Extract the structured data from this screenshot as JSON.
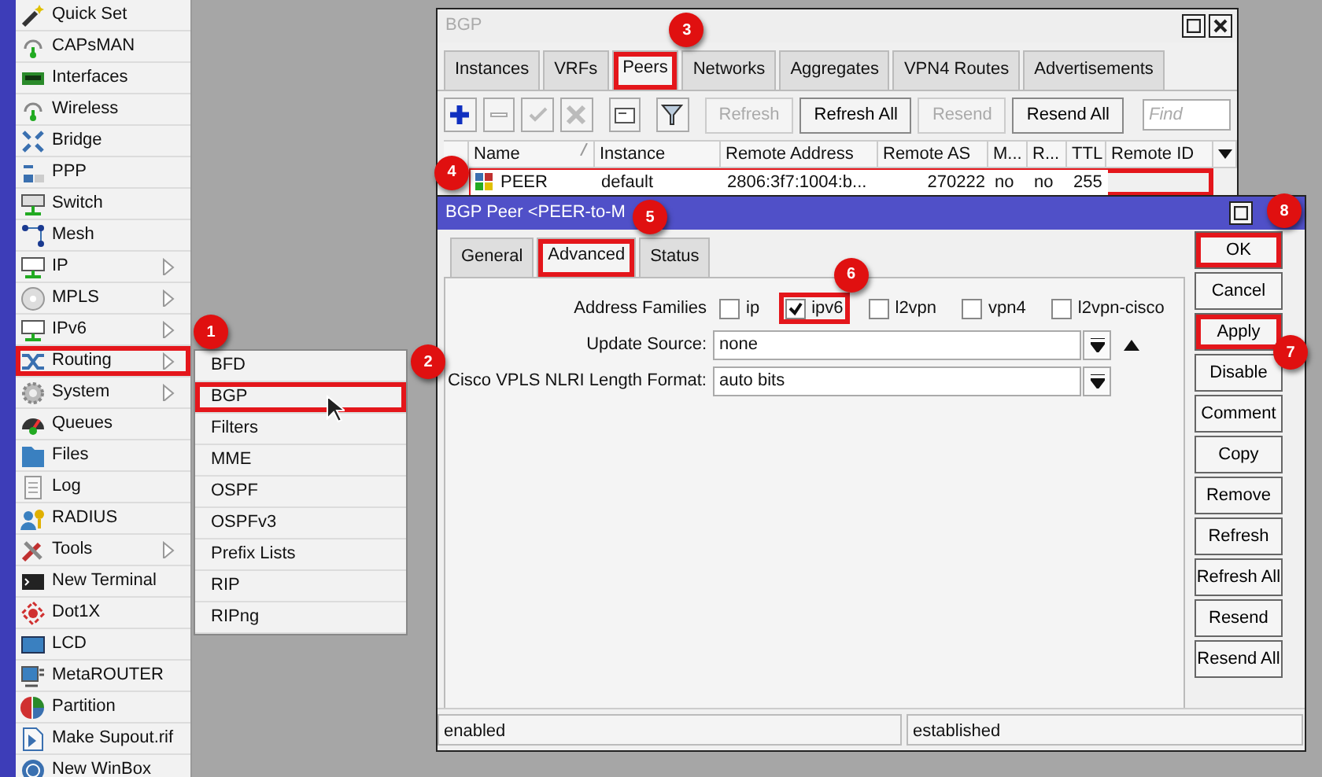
{
  "sidebar": {
    "items": [
      {
        "label": "Quick Set",
        "submenu": false
      },
      {
        "label": "CAPsMAN",
        "submenu": false
      },
      {
        "label": "Interfaces",
        "submenu": false
      },
      {
        "label": "Wireless",
        "submenu": false
      },
      {
        "label": "Bridge",
        "submenu": false
      },
      {
        "label": "PPP",
        "submenu": false
      },
      {
        "label": "Switch",
        "submenu": false
      },
      {
        "label": "Mesh",
        "submenu": false
      },
      {
        "label": "IP",
        "submenu": true
      },
      {
        "label": "MPLS",
        "submenu": true
      },
      {
        "label": "IPv6",
        "submenu": true
      },
      {
        "label": "Routing",
        "submenu": true,
        "marked": true,
        "badge": "1"
      },
      {
        "label": "System",
        "submenu": true
      },
      {
        "label": "Queues",
        "submenu": false
      },
      {
        "label": "Files",
        "submenu": false
      },
      {
        "label": "Log",
        "submenu": false
      },
      {
        "label": "RADIUS",
        "submenu": false
      },
      {
        "label": "Tools",
        "submenu": true
      },
      {
        "label": "New Terminal",
        "submenu": false
      },
      {
        "label": "Dot1X",
        "submenu": false
      },
      {
        "label": "LCD",
        "submenu": false
      },
      {
        "label": "MetaROUTER",
        "submenu": false
      },
      {
        "label": "Partition",
        "submenu": false
      },
      {
        "label": "Make Supout.rif",
        "submenu": false
      },
      {
        "label": "New WinBox",
        "submenu": false
      }
    ]
  },
  "submenu": {
    "items": [
      {
        "label": "BFD"
      },
      {
        "label": "BGP",
        "marked": true,
        "badge": "2"
      },
      {
        "label": "Filters"
      },
      {
        "label": "MME"
      },
      {
        "label": "OSPF"
      },
      {
        "label": "OSPFv3"
      },
      {
        "label": "Prefix Lists"
      },
      {
        "label": "RIP"
      },
      {
        "label": "RIPng"
      }
    ]
  },
  "bgp_window": {
    "title": "BGP",
    "tabs": [
      {
        "label": "Instances",
        "selected": false
      },
      {
        "label": "VRFs",
        "selected": false
      },
      {
        "label": "Peers",
        "selected": true,
        "marked": true,
        "badge": "3"
      },
      {
        "label": "Networks",
        "selected": false
      },
      {
        "label": "Aggregates",
        "selected": false
      },
      {
        "label": "VPN4 Routes",
        "selected": false
      },
      {
        "label": "Advertisements",
        "selected": false
      }
    ],
    "toolbar_buttons": [
      {
        "label": "Refresh",
        "disabled": true
      },
      {
        "label": "Refresh All",
        "disabled": false
      },
      {
        "label": "Resend",
        "disabled": true
      },
      {
        "label": "Resend All",
        "disabled": false
      }
    ],
    "find_placeholder": "Find",
    "table": {
      "columns": [
        "Name",
        "Instance",
        "Remote Address",
        "Remote AS",
        "M...",
        "R...",
        "TTL",
        "Remote ID"
      ],
      "rows": [
        {
          "cells": [
            "PEER",
            "default",
            "2806:3f7:1004:b...",
            "270222",
            "no",
            "no",
            "255"
          ],
          "marked": true,
          "badge": "4"
        }
      ]
    }
  },
  "peer_dialog": {
    "title": "BGP Peer <PEER-to-M",
    "tabs": [
      {
        "label": "General",
        "selected": false
      },
      {
        "label": "Advanced",
        "selected": true,
        "marked": true,
        "badge": "5"
      },
      {
        "label": "Status",
        "selected": false
      }
    ],
    "address_families": {
      "label": "Address Families",
      "options": [
        {
          "label": "ip",
          "checked": false
        },
        {
          "label": "ipv6",
          "checked": true,
          "marked": true,
          "badge": "6"
        },
        {
          "label": "l2vpn",
          "checked": false
        },
        {
          "label": "vpn4",
          "checked": false
        },
        {
          "label": "l2vpn-cisco",
          "checked": false
        }
      ]
    },
    "fields": [
      {
        "label": "Update Source:",
        "value": "none",
        "kind": "dropdown-with-toggle"
      },
      {
        "label": "Cisco VPLS NLRI Length Format:",
        "value": "auto bits",
        "kind": "dropdown"
      }
    ],
    "buttons": [
      {
        "label": "OK",
        "marked": true,
        "badge": "8"
      },
      {
        "label": "Cancel"
      },
      {
        "label": "Apply",
        "marked": true,
        "badge": "7"
      },
      {
        "label": "Disable"
      },
      {
        "label": "Comment"
      },
      {
        "label": "Copy"
      },
      {
        "label": "Remove"
      },
      {
        "label": "Refresh"
      },
      {
        "label": "Refresh All"
      },
      {
        "label": "Resend"
      },
      {
        "label": "Resend All"
      }
    ],
    "status_bar": [
      "enabled",
      "established"
    ]
  }
}
